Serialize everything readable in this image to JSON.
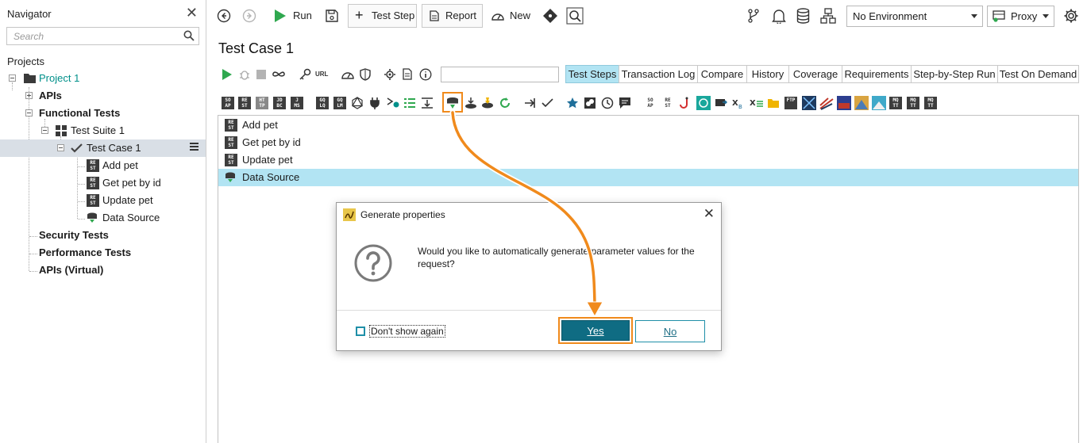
{
  "navigator": {
    "title": "Navigator",
    "search_placeholder": "Search",
    "projects_label": "Projects",
    "tree": {
      "project": "Project 1",
      "apis": "APIs",
      "functional_tests": "Functional Tests",
      "test_suite": "Test Suite 1",
      "test_case": "Test Case 1",
      "steps": [
        "Add pet",
        "Get pet by id",
        "Update pet",
        "Data Source"
      ],
      "security_tests": "Security Tests",
      "performance_tests": "Performance Tests",
      "apis_virtual": "APIs (Virtual)"
    }
  },
  "toolbar": {
    "run": "Run",
    "test_step": "Test Step",
    "report": "Report",
    "new": "New",
    "environment": "No Environment",
    "proxy": "Proxy"
  },
  "test_case": {
    "title": "Test Case 1",
    "url_label": "URL",
    "tabs": [
      "Test Steps",
      "Transaction Log",
      "Compare",
      "History",
      "Coverage",
      "Requirements",
      "Step-by-Step Run",
      "Test On Demand"
    ],
    "steps": [
      "Add pet",
      "Get pet by id",
      "Update pet",
      "Data Source"
    ]
  },
  "dialog": {
    "title": "Generate properties",
    "message": "Would you like to automatically generate parameter values for the request?",
    "dont_show": "Don't show again",
    "yes": "Yes",
    "no": "No"
  },
  "colors": {
    "teal_accent": "#00908a",
    "selection": "#b2e4f3",
    "highlight_orange": "#f08a1c",
    "primary_button": "#0f6c83",
    "run_green": "#2fa84f"
  }
}
